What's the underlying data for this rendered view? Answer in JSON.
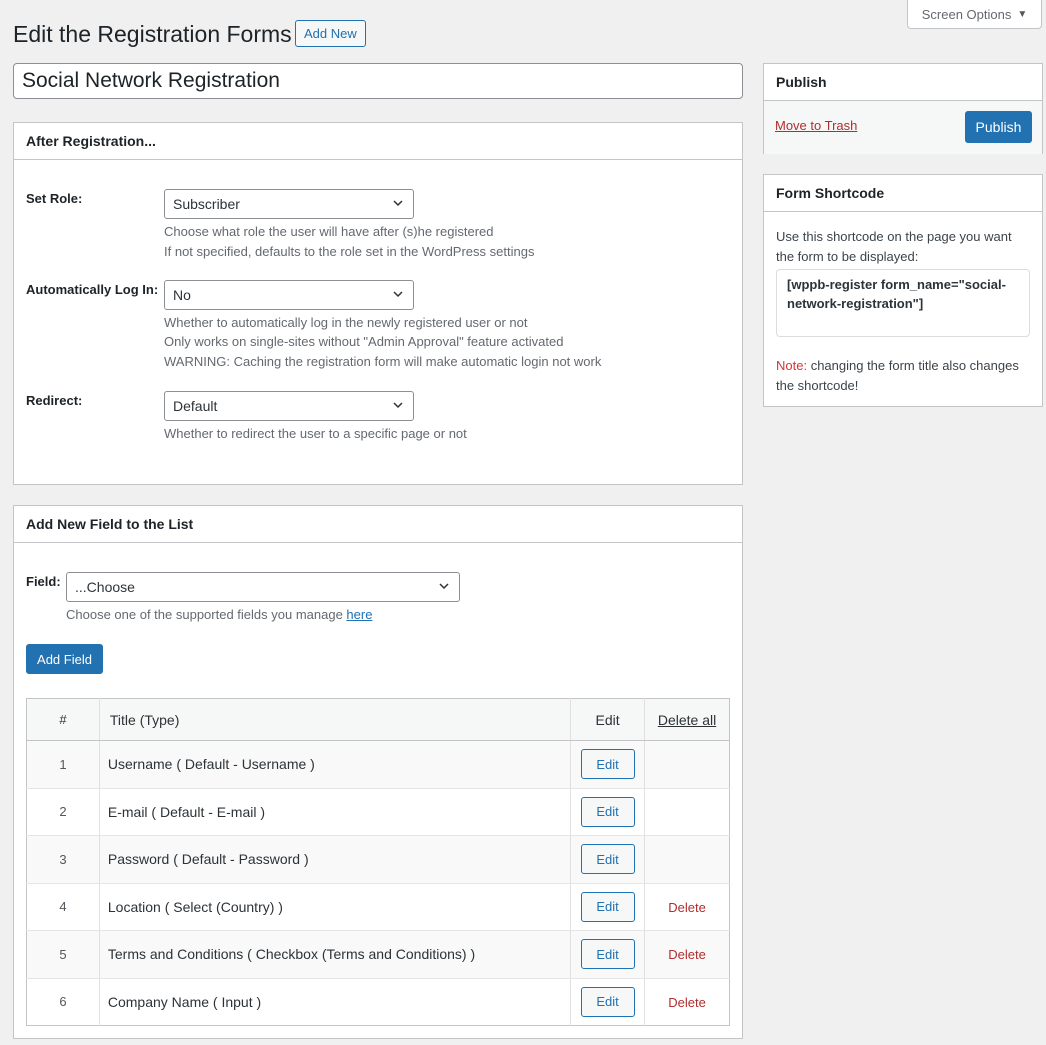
{
  "header": {
    "screen_options_label": "Screen Options",
    "page_title": "Edit the Registration Forms",
    "add_new_label": "Add New"
  },
  "form_title": "Social Network Registration",
  "after_registration": {
    "title": "After Registration...",
    "set_role": {
      "label": "Set Role:",
      "value": "Subscriber",
      "desc_1": "Choose what role the user will have after (s)he registered",
      "desc_2": "If not specified, defaults to the role set in the WordPress settings"
    },
    "auto_login": {
      "label": "Automatically Log In:",
      "value": "No",
      "desc_1": "Whether to automatically log in the newly registered user or not",
      "desc_2": "Only works on single-sites without \"Admin Approval\" feature activated",
      "desc_3": "WARNING: Caching the registration form will make automatic login not work"
    },
    "redirect": {
      "label": "Redirect:",
      "value": "Default",
      "desc_1": "Whether to redirect the user to a specific page or not"
    }
  },
  "publish": {
    "title": "Publish",
    "trash_label": "Move to Trash",
    "publish_label": "Publish"
  },
  "shortcode": {
    "title": "Form Shortcode",
    "desc": "Use this shortcode on the page you want the form to be displayed:",
    "code": "[wppb-register form_name=\"social-network-registration\"]",
    "note_label": "Note:",
    "note_text": " changing the form title also changes the shortcode!"
  },
  "add_field": {
    "title": "Add New Field to the List",
    "field_label": "Field:",
    "field_value": "...Choose",
    "desc_prefix": "Choose one of the supported fields you manage ",
    "desc_link": "here",
    "add_button": "Add Field"
  },
  "table": {
    "headers": {
      "num": "#",
      "title": "Title (Type)",
      "edit": "Edit",
      "delete_all": "Delete all"
    },
    "edit_label": "Edit",
    "delete_label": "Delete",
    "rows": [
      {
        "num": "1",
        "title": "Username ( Default - Username )",
        "deletable": false
      },
      {
        "num": "2",
        "title": "E-mail ( Default - E-mail )",
        "deletable": false
      },
      {
        "num": "3",
        "title": "Password ( Default - Password )",
        "deletable": false
      },
      {
        "num": "4",
        "title": "Location ( Select (Country) )",
        "deletable": true
      },
      {
        "num": "5",
        "title": "Terms and Conditions ( Checkbox (Terms and Conditions) )",
        "deletable": true
      },
      {
        "num": "6",
        "title": "Company Name ( Input )",
        "deletable": true
      }
    ]
  },
  "colors": {
    "accent": "#2271b1",
    "danger": "#b32d2e",
    "background": "#f0f0f1"
  }
}
